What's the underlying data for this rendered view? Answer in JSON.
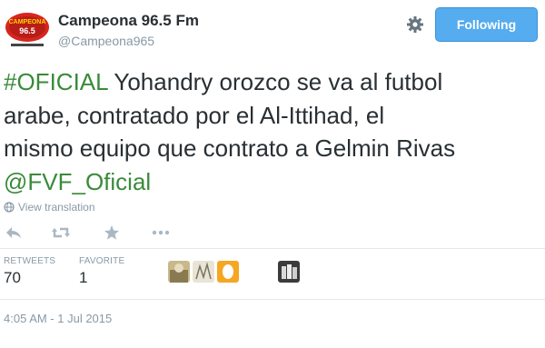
{
  "profile": {
    "name": "Campeona 96.5 Fm",
    "handle": "@Campeona965",
    "logo_text": "CAMPEONA",
    "logo_number": "96.5"
  },
  "header": {
    "follow_label": "Following"
  },
  "tweet": {
    "hashtag": "#OFICIAL",
    "line1_rest": " Yohandry orozco se va al futbol",
    "line2": "arabe, contratado por el  Al-Ittihad, el",
    "line3": "mismo equipo que contrato a Gelmin Rivas",
    "mention": "@FVF_Oficial"
  },
  "translation": {
    "label": "View translation"
  },
  "actions": {
    "reply_icon": "reply-icon",
    "retweet_icon": "retweet-icon",
    "favorite_icon": "star-icon",
    "more_icon": "more-icon"
  },
  "stats": {
    "retweets_label": "RETWEETS",
    "retweets_count": "70",
    "favorites_label": "FAVORITE",
    "favorites_count": "1"
  },
  "timestamp": "4:05 AM - 1 Jul 2015",
  "colors": {
    "accent": "#55acee",
    "link_green": "#3a8a3a",
    "muted": "#8899a6",
    "text": "#292f33"
  }
}
